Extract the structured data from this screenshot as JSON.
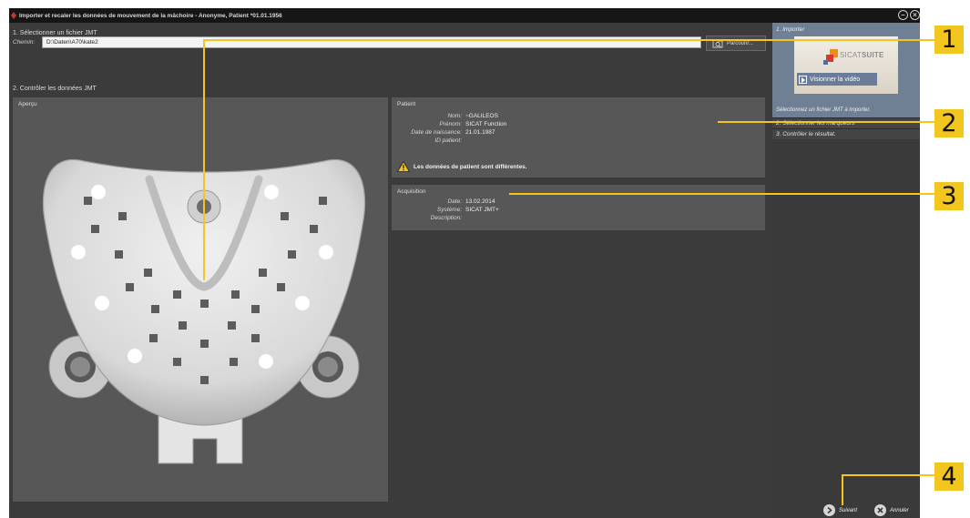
{
  "window": {
    "title": "Importer et recaler les données de mouvement de la mâchoire - Anonyme, Patient *01.01.1956"
  },
  "section1": {
    "title": "1. Sélectionner un fichier JMT",
    "path_label": "Chemin:",
    "path_value": "D:\\Daten\\A70\\kate2",
    "browse_label": "Parcourir..."
  },
  "section2": {
    "title": "2. Contrôler les données JMT",
    "preview_title": "Aperçu"
  },
  "patient": {
    "title": "Patient",
    "fields": [
      {
        "label": "Nom:",
        "value": "~GALILEOS"
      },
      {
        "label": "Prénom:",
        "value": "SICAT Function"
      },
      {
        "label": "Date de naissance:",
        "value": "21.01.1987"
      },
      {
        "label": "ID patient:",
        "value": ""
      }
    ],
    "warning": "Les données de patient sont différentes."
  },
  "acquisition": {
    "title": "Acquisition",
    "fields": [
      {
        "label": "Date:",
        "value": "13.02.2014"
      },
      {
        "label": "Système:",
        "value": "SICAT JMT+"
      },
      {
        "label": "Description:",
        "value": ""
      }
    ]
  },
  "sidebar": {
    "step1_title": "1. Importer",
    "brand_light": "SICAT",
    "brand_bold": "SUITE",
    "video_label": "Visionner la vidéo",
    "step1_desc": "Sélectionnez un fichier JMT à importer.",
    "step2": "2. Sélectionner les marqueurs",
    "step3": "3. Contrôler le résultat."
  },
  "footer": {
    "next_label": "Suivant",
    "cancel_label": "Annuler"
  },
  "callouts": [
    "1",
    "2",
    "3",
    "4"
  ],
  "colors": {
    "accent_callout": "#f3c51f",
    "window_bg": "#3b3b3b",
    "panel_bg": "#575757",
    "active_step_bg": "#6f7f94"
  }
}
